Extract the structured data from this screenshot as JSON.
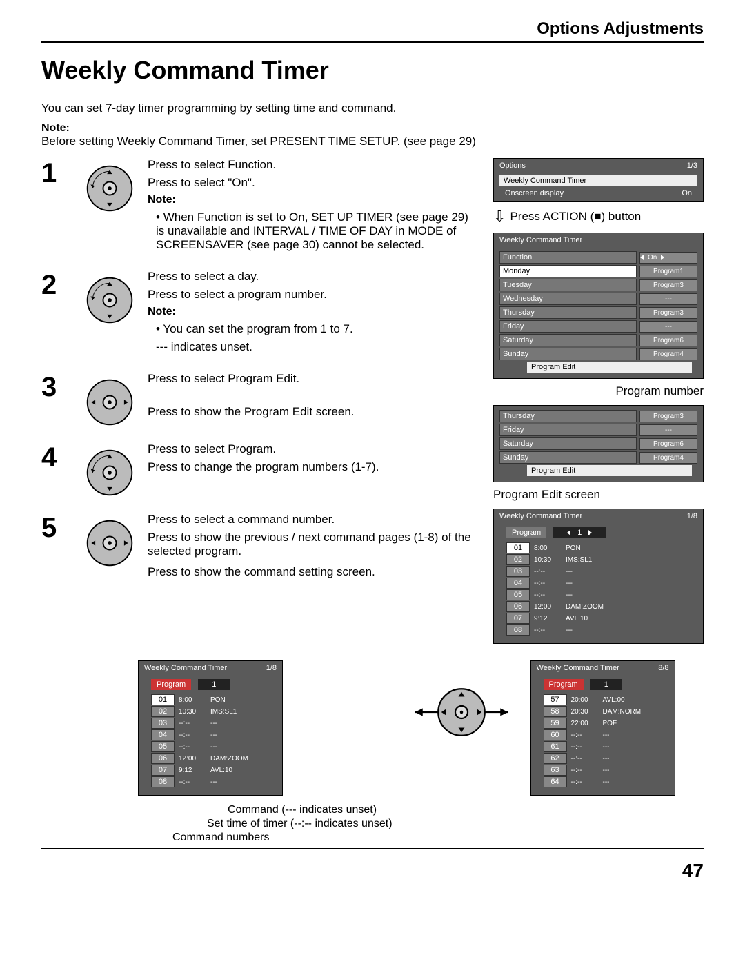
{
  "header": {
    "section": "Options Adjustments",
    "title": "Weekly Command Timer",
    "page": "47"
  },
  "intro": "You can set 7-day timer programming by setting time and command.",
  "topnote": {
    "label": "Note:",
    "text": "Before setting Weekly Command Timer, set PRESENT TIME SETUP. (see page 29)"
  },
  "steps": {
    "s1": {
      "num": "1",
      "a": "Press to select Function.",
      "b": "Press to select \"On\".",
      "nlabel": "Note:",
      "n": "When Function is set to On, SET UP TIMER (see page 29) is unavailable and INTERVAL / TIME OF DAY in MODE of SCREENSAVER (see page 30) cannot be selected."
    },
    "s2": {
      "num": "2",
      "a": "Press to select a day.",
      "b": "Press to select a program number.",
      "nlabel": "Note:",
      "n1": "You can set the program from 1 to 7.",
      "n2": "--- indicates unset."
    },
    "s3": {
      "num": "3",
      "a": "Press to select Program Edit.",
      "b": "Press to show the Program Edit screen."
    },
    "s4": {
      "num": "4",
      "a": "Press to select Program.",
      "b": "Press to change the program numbers (1-7)."
    },
    "s5": {
      "num": "5",
      "a": "Press to select a command number.",
      "b": "Press to show the previous / next command pages (1-8) of the selected program.",
      "c": "Press to show the command setting screen."
    }
  },
  "right": {
    "options": {
      "title": "Options",
      "page": "1/3",
      "item": "Weekly Command Timer",
      "osd_k": "Onscreen display",
      "osd_v": "On"
    },
    "action": "Press ACTION (■) button",
    "wct": {
      "title": "Weekly Command Timer",
      "func_k": "Function",
      "func_v": "On",
      "days": [
        {
          "d": "Monday",
          "p": "Program1",
          "sel": true
        },
        {
          "d": "Tuesday",
          "p": "Program3"
        },
        {
          "d": "Wednesday",
          "p": "---"
        },
        {
          "d": "Thursday",
          "p": "Program3"
        },
        {
          "d": "Friday",
          "p": "---"
        },
        {
          "d": "Saturday",
          "p": "Program6"
        },
        {
          "d": "Sunday",
          "p": "Program4"
        }
      ],
      "edit": "Program Edit"
    },
    "pn_label": "Program number",
    "snip": {
      "days": [
        {
          "d": "Thursday",
          "p": "Program3"
        },
        {
          "d": "Friday",
          "p": "---"
        },
        {
          "d": "Saturday",
          "p": "Program6"
        },
        {
          "d": "Sunday",
          "p": "Program4"
        }
      ],
      "edit": "Program Edit"
    },
    "pe_label": "Program Edit screen",
    "pe": {
      "title": "Weekly Command Timer",
      "page": "1/8",
      "prog_k": "Program",
      "prog_v": "1",
      "rows": [
        {
          "n": "01",
          "t": "8:00",
          "c": "PON",
          "sel": true
        },
        {
          "n": "02",
          "t": "10:30",
          "c": "IMS:SL1"
        },
        {
          "n": "03",
          "t": "--:--",
          "c": "---"
        },
        {
          "n": "04",
          "t": "--:--",
          "c": "---"
        },
        {
          "n": "05",
          "t": "--:--",
          "c": "---"
        },
        {
          "n": "06",
          "t": "12:00",
          "c": "DAM:ZOOM"
        },
        {
          "n": "07",
          "t": "9:12",
          "c": "AVL:10"
        },
        {
          "n": "08",
          "t": "--:--",
          "c": "---"
        }
      ]
    }
  },
  "bottom": {
    "left": {
      "title": "Weekly Command Timer",
      "page": "1/8",
      "prog_k": "Program",
      "prog_v": "1",
      "rows": [
        {
          "n": "01",
          "t": "8:00",
          "c": "PON",
          "sel": true
        },
        {
          "n": "02",
          "t": "10:30",
          "c": "IMS:SL1"
        },
        {
          "n": "03",
          "t": "--:--",
          "c": "---"
        },
        {
          "n": "04",
          "t": "--:--",
          "c": "---"
        },
        {
          "n": "05",
          "t": "--:--",
          "c": "---"
        },
        {
          "n": "06",
          "t": "12:00",
          "c": "DAM:ZOOM"
        },
        {
          "n": "07",
          "t": "9:12",
          "c": "AVL:10"
        },
        {
          "n": "08",
          "t": "--:--",
          "c": "---"
        }
      ]
    },
    "right": {
      "title": "Weekly Command Timer",
      "page": "8/8",
      "prog_k": "Program",
      "prog_v": "1",
      "rows": [
        {
          "n": "57",
          "t": "20:00",
          "c": "AVL:00",
          "sel": true
        },
        {
          "n": "58",
          "t": "20:30",
          "c": "DAM:NORM"
        },
        {
          "n": "59",
          "t": "22:00",
          "c": "POF"
        },
        {
          "n": "60",
          "t": "--:--",
          "c": "---"
        },
        {
          "n": "61",
          "t": "--:--",
          "c": "---"
        },
        {
          "n": "62",
          "t": "--:--",
          "c": "---"
        },
        {
          "n": "63",
          "t": "--:--",
          "c": "---"
        },
        {
          "n": "64",
          "t": "--:--",
          "c": "---"
        }
      ]
    },
    "legend": {
      "a": "Command (--- indicates unset)",
      "b": "Set time of timer (--:-- indicates unset)",
      "c": "Command numbers"
    }
  }
}
